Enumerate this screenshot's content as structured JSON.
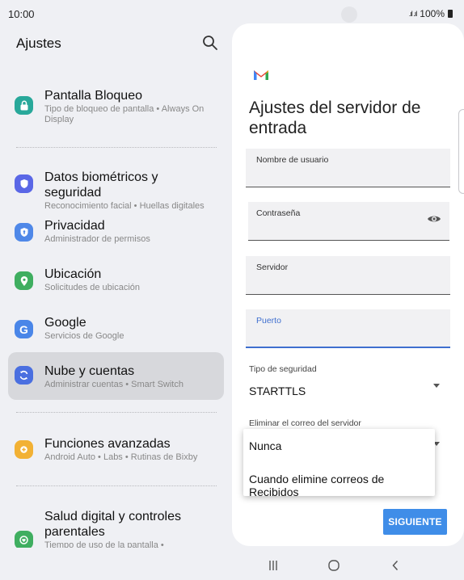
{
  "status_bar": {
    "time": "10:00",
    "battery": "100%",
    "signal": ".ıl .ıl"
  },
  "settings": {
    "title": "Ajustes",
    "items": [
      {
        "title": "Pantalla Bloqueo",
        "subtitle": "Tipo de bloqueo de pantalla • Always On Display",
        "icon": "lock-icon",
        "color": "#28a89a"
      },
      {
        "title": "Datos biométricos y seguridad",
        "subtitle": "Reconocimiento facial • Huellas digitales",
        "icon": "shield-icon",
        "color": "#5a67e6"
      },
      {
        "title": "Privacidad",
        "subtitle": "Administrador de permisos",
        "icon": "privacy-shield-icon",
        "color": "#4f88e8"
      },
      {
        "title": "Ubicación",
        "subtitle": "Solicitudes de ubicación",
        "icon": "location-pin-icon",
        "color": "#3fae60"
      },
      {
        "title": "Google",
        "subtitle": "Servicios de Google",
        "icon": "google-icon",
        "color": "#4a86e8"
      },
      {
        "title": "Nube y cuentas",
        "subtitle": "Administrar cuentas • Smart Switch",
        "icon": "sync-icon",
        "color": "#4a6fe0",
        "selected": true
      },
      {
        "title": "Funciones avanzadas",
        "subtitle": "Android Auto • Labs • Rutinas de Bixby",
        "icon": "gear-plus-icon",
        "color": "#f2b134"
      },
      {
        "title": "Salud digital y controles parentales",
        "subtitle": "Tiempo de uso de la pantalla •",
        "icon": "digital-wellbeing-icon",
        "color": "#3fae60"
      }
    ]
  },
  "incoming_server": {
    "title": "Ajustes del servidor de entrada",
    "fields": {
      "username": {
        "label": "Nombre de usuario",
        "value": ""
      },
      "password": {
        "label": "Contraseña",
        "value": ""
      },
      "server": {
        "label": "Servidor",
        "value": ""
      },
      "port": {
        "label": "Puerto",
        "value": ""
      }
    },
    "security_type": {
      "label": "Tipo de seguridad",
      "value": "STARTTLS"
    },
    "delete_email": {
      "label": "Eliminar el correo del servidor"
    },
    "next_button": "SIGUIENTE"
  },
  "dropdown": {
    "options": [
      "Nunca",
      "Cuando elimine correos de Recibidos"
    ]
  },
  "colors": {
    "accent": "#3f8de8",
    "selected_bg": "#d7d8dc",
    "gmail_red": "#ea4335"
  }
}
